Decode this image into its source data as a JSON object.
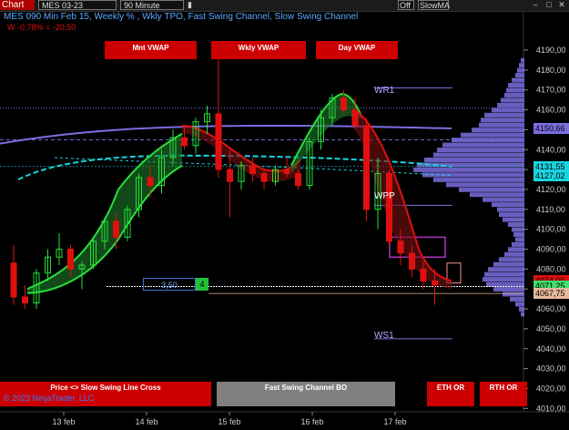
{
  "toolbar": {
    "chart_label": "Chart",
    "instrument": "MES 03-23",
    "interval": "90 Minute",
    "right_field_value": "Off",
    "slow_ma_label": "SlowMA"
  },
  "header": {
    "title": "MES 090 Min Feb 15, Weekly % , Wkly TPO, Fast Swing Channel, Slow Swing Channel",
    "weekly_change": "W -0,78% = -20,50"
  },
  "buttons": {
    "mnt_vwap": "Mnt VWAP",
    "wkly_vwap": "Wkly VWAP",
    "day_vwap": "Day VWAP",
    "price_cross": "Price <> Slow Swing Line Cross",
    "fast_swing_bo": "Fast Swing Channel BO",
    "eth_or": "ETH OR",
    "rth_or": "RTH OR"
  },
  "labels": {
    "wr1": "WR1",
    "wpp": "WPP",
    "ws1": "WS1",
    "box_value": "3,50",
    "box_count": "4",
    "copyright": "© 2023 NinjaTrader, LLC"
  },
  "price_axis": {
    "ticks": [
      "4190,00",
      "4180,00",
      "4170,00",
      "4160,00",
      "4150,00",
      "4140,00",
      "4130,00",
      "4120,00",
      "4110,00",
      "4100,00",
      "4090,00",
      "4080,00",
      "4070,00",
      "4060,00",
      "4050,00",
      "4040,00",
      "4030,00",
      "4020,00",
      "4010,00"
    ],
    "markers": [
      {
        "value": "4150,66",
        "color": "#7b6ee0"
      },
      {
        "value": "4131,55",
        "color": "#19d4e0"
      },
      {
        "value": "4127,02",
        "color": "#19d4e0"
      },
      {
        "value": "4074,00",
        "color": "#e01010"
      },
      {
        "value": "4071,25",
        "color": "#3ee06a"
      },
      {
        "value": "4067,75",
        "color": "#e8b89a"
      }
    ]
  },
  "time_axis": {
    "labels": [
      "13 feb",
      "14 feb",
      "15 feb",
      "16 feb",
      "17 feb"
    ]
  },
  "colors": {
    "bull": "#25e03a",
    "bear": "#e01010",
    "vwap_month": "#7b6ee0",
    "vwap_week": "#19d4e0",
    "profile": "#7b6ee0",
    "button_red": "#cc0000"
  }
}
